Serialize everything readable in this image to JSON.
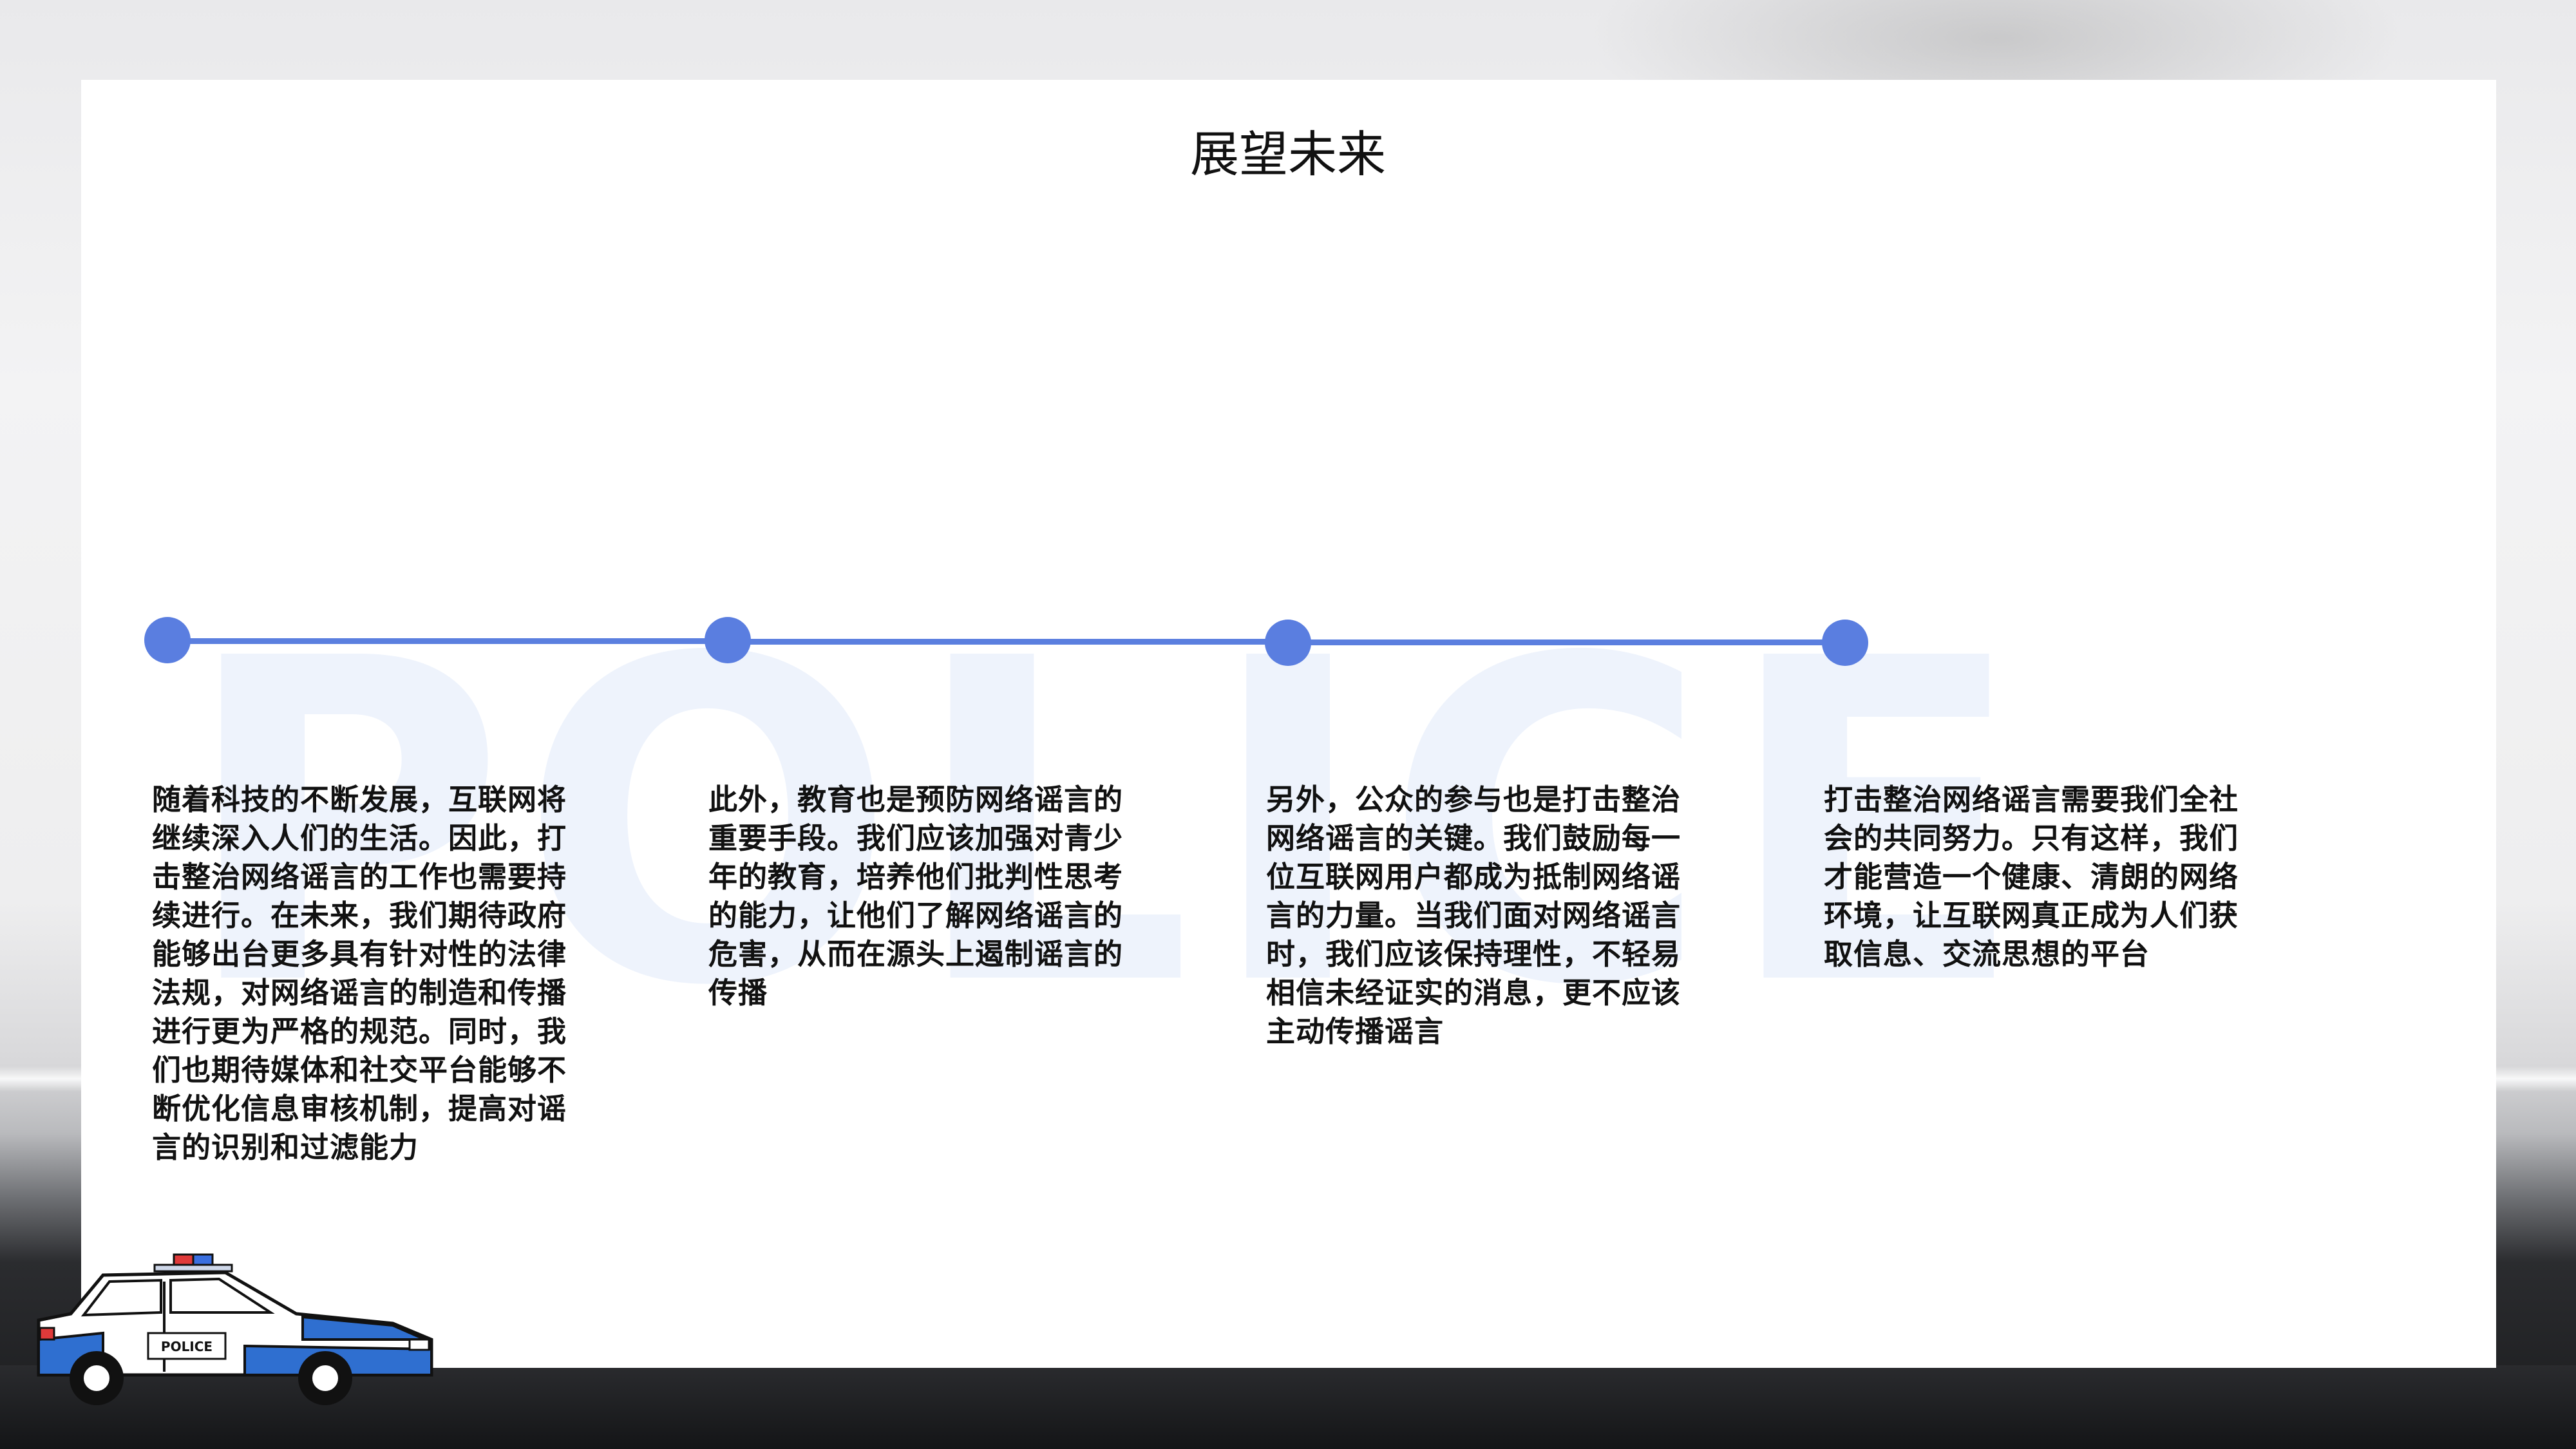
{
  "slide": {
    "title": "展望未来",
    "watermark": "POLICE",
    "accent_color": "#5b7fdf",
    "points": [
      {
        "text": "随着科技的不断发展，互联网将继续深入人们的生活。因此，打击整治网络谣言的工作也需要持续进行。在未来，我们期待政府能够出台更多具有针对性的法律法规，对网络谣言的制造和传播进行更为严格的规范。同时，我们也期待媒体和社交平台能够不断优化信息审核机制，提高对谣言的识别和过滤能力"
      },
      {
        "text": "此外，教育也是预防网络谣言的重要手段。我们应该加强对青少年的教育，培养他们批判性思考的能力，让他们了解网络谣言的危害，从而在源头上遏制谣言的传播"
      },
      {
        "text": "另外，公众的参与也是打击整治网络谣言的关键。我们鼓励每一位互联网用户都成为抵制网络谣言的力量。当我们面对网络谣言时，我们应该保持理性，不轻易相信未经证实的消息，更不应该主动传播谣言"
      },
      {
        "text": "打击整治网络谣言需要我们全社会的共同努力。只有这样，我们才能营造一个健康、清朗的网络环境，让互联网真正成为人们获取信息、交流思想的平台"
      }
    ],
    "car_badge": "POLICE"
  }
}
